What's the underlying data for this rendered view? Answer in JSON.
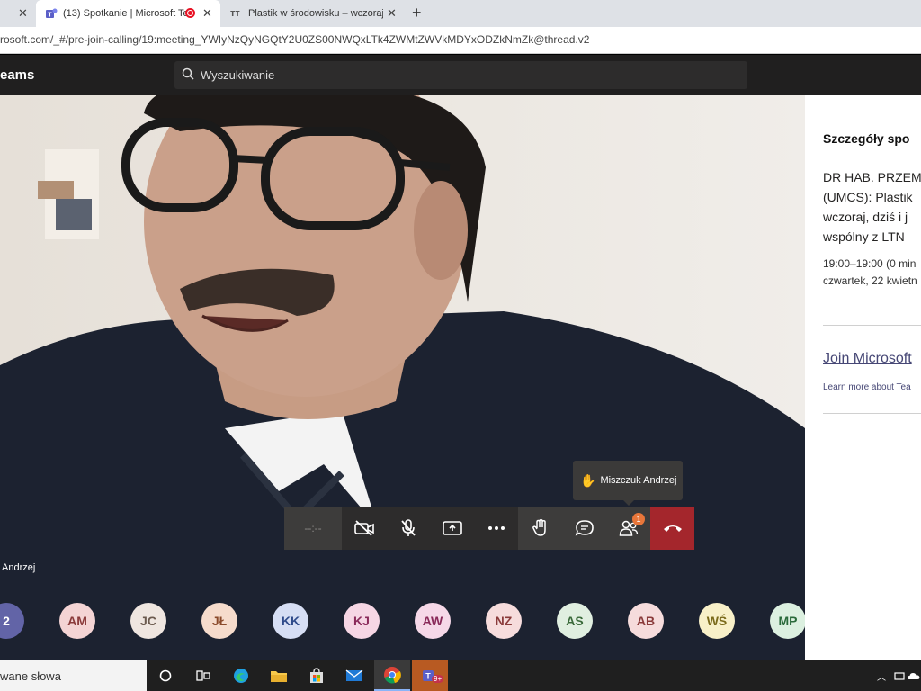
{
  "browser": {
    "tabs": [
      {
        "title": "(13) Spotkanie | Microsoft Te"
      },
      {
        "title": "Plastik w środowisku – wczoraj, d"
      }
    ],
    "url": "rosoft.com/_#/pre-join-calling/19:meeting_YWIyNzQyNGQtY2U0ZS00NWQxLTk4ZWMtZWVkMDYxODZkNmZk@thread.v2"
  },
  "teams": {
    "app_title": "eams",
    "search_placeholder": "Wyszukiwanie"
  },
  "meeting": {
    "speaker_name": "Andrzej",
    "timer": "--:--",
    "raised_hand_tooltip": "Miszczuk Andrzej",
    "participants_badge": "1"
  },
  "side_panel": {
    "title": "Szczegóły spo",
    "description_lines": [
      "DR HAB. PRZEM",
      "(UMCS): Plastik",
      "wczoraj, dziś i j",
      "wspólny z LTN"
    ],
    "time": "19:00–19:00 (0 min",
    "date": "czwartek, 22 kwietn",
    "join_link": "Join Microsoft",
    "learn_more": "Learn more about Tea"
  },
  "participants": [
    {
      "initials": "2",
      "bg": "#6264a7",
      "fg": "#ffffff"
    },
    {
      "initials": "AM",
      "bg": "#f4d4d4",
      "fg": "#8a3a3a"
    },
    {
      "initials": "JC",
      "bg": "#efe6e0",
      "fg": "#6b5a4e"
    },
    {
      "initials": "JŁ",
      "bg": "#f6dccc",
      "fg": "#8a4a2a"
    },
    {
      "initials": "KK",
      "bg": "#d6def4",
      "fg": "#2e4a8a"
    },
    {
      "initials": "KJ",
      "bg": "#f6d6e4",
      "fg": "#8a2a5a"
    },
    {
      "initials": "AW",
      "bg": "#f6d8e8",
      "fg": "#8a2a5a"
    },
    {
      "initials": "NZ",
      "bg": "#f6dcdc",
      "fg": "#8a3a3a"
    },
    {
      "initials": "AS",
      "bg": "#e0efe0",
      "fg": "#3a6a3a"
    },
    {
      "initials": "AB",
      "bg": "#f6dcdc",
      "fg": "#8a3a3a"
    },
    {
      "initials": "WŚ",
      "bg": "#f8f0c8",
      "fg": "#7a6a1a"
    },
    {
      "initials": "MP",
      "bg": "#dcf0e0",
      "fg": "#2a6a3a"
    }
  ],
  "taskbar": {
    "search_text": "wane słowa",
    "teams_badge": "9+"
  },
  "colors": {
    "teams_dark": "#201f1f",
    "hangup": "#a4262c",
    "teams_purple": "#464775"
  }
}
